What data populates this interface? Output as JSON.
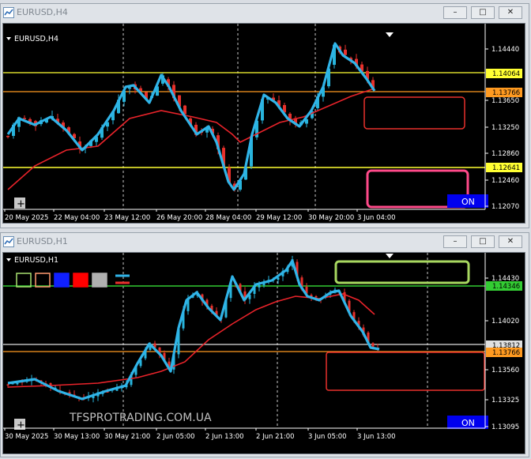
{
  "colors": {
    "bull": "#28b4dc",
    "bear": "#e8312c",
    "ma": "#e8232a",
    "zigzag": "#30b4e8",
    "yellow": "#ffff33",
    "orange": "#ff9a20",
    "green_line": "#33cc33",
    "white_line": "#e0e0e0"
  },
  "top_window": {
    "title": "EURUSD,H4",
    "chart_label": "EURUSD,H4",
    "price_ticks": [
      "1.14440",
      "1.13650",
      "1.13250",
      "1.12860",
      "1.12460",
      "1.12070"
    ],
    "tags": [
      {
        "text": "1.14064",
        "color": "#ffff33"
      },
      {
        "text": "1.13766",
        "color": "#ff9a20"
      },
      {
        "text": "1.12641",
        "color": "#ffff33"
      }
    ],
    "date_ticks": [
      "20 May 2025",
      "22 May 04:00",
      "23 May 12:00",
      "26 May 20:00",
      "28 May 04:00",
      "29 May 12:00",
      "30 May 20:00",
      "3 Jun 04:00"
    ],
    "on_button": "ON",
    "plus": "+"
  },
  "bottom_window": {
    "title": "EURUSD,H1",
    "chart_label": "EURUSD,H1",
    "price_ticks": [
      "1.14430",
      "1.14020",
      "1.13560",
      "1.13325",
      "1.13095"
    ],
    "tags": [
      {
        "text": "1.14346",
        "color": "#33cc33"
      },
      {
        "text": "1.13812",
        "color": "#e0e0e0"
      },
      {
        "text": "1.13766",
        "color": "#ff9a20"
      }
    ],
    "date_ticks": [
      "30 May 2025",
      "30 May 13:00",
      "30 May 21:00",
      "2 Jun 05:00",
      "2 Jun 13:00",
      "2 Jun 21:00",
      "3 Jun 05:00",
      "3 Jun 13:00"
    ],
    "watermark": "TFSPROTRADING.COM.UA",
    "on_button": "ON",
    "plus": "+",
    "color_swatches": [
      "#ffffff",
      "#ff9a20",
      "#1020ff",
      "#ff0000",
      "#b0b0b0"
    ]
  }
}
